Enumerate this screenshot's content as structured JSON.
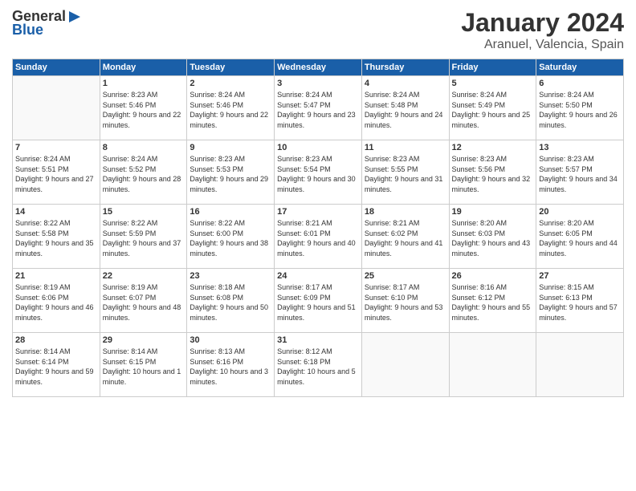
{
  "header": {
    "logo": {
      "general": "General",
      "blue": "Blue",
      "arrowIcon": "▶"
    },
    "title": "January 2024",
    "location": "Aranuel, Valencia, Spain"
  },
  "weekdays": [
    "Sunday",
    "Monday",
    "Tuesday",
    "Wednesday",
    "Thursday",
    "Friday",
    "Saturday"
  ],
  "weeks": [
    [
      {
        "day": "",
        "sunrise": "",
        "sunset": "",
        "daylight": ""
      },
      {
        "day": "1",
        "sunrise": "Sunrise: 8:23 AM",
        "sunset": "Sunset: 5:46 PM",
        "daylight": "Daylight: 9 hours and 22 minutes."
      },
      {
        "day": "2",
        "sunrise": "Sunrise: 8:24 AM",
        "sunset": "Sunset: 5:46 PM",
        "daylight": "Daylight: 9 hours and 22 minutes."
      },
      {
        "day": "3",
        "sunrise": "Sunrise: 8:24 AM",
        "sunset": "Sunset: 5:47 PM",
        "daylight": "Daylight: 9 hours and 23 minutes."
      },
      {
        "day": "4",
        "sunrise": "Sunrise: 8:24 AM",
        "sunset": "Sunset: 5:48 PM",
        "daylight": "Daylight: 9 hours and 24 minutes."
      },
      {
        "day": "5",
        "sunrise": "Sunrise: 8:24 AM",
        "sunset": "Sunset: 5:49 PM",
        "daylight": "Daylight: 9 hours and 25 minutes."
      },
      {
        "day": "6",
        "sunrise": "Sunrise: 8:24 AM",
        "sunset": "Sunset: 5:50 PM",
        "daylight": "Daylight: 9 hours and 26 minutes."
      }
    ],
    [
      {
        "day": "7",
        "sunrise": "Sunrise: 8:24 AM",
        "sunset": "Sunset: 5:51 PM",
        "daylight": "Daylight: 9 hours and 27 minutes."
      },
      {
        "day": "8",
        "sunrise": "Sunrise: 8:24 AM",
        "sunset": "Sunset: 5:52 PM",
        "daylight": "Daylight: 9 hours and 28 minutes."
      },
      {
        "day": "9",
        "sunrise": "Sunrise: 8:23 AM",
        "sunset": "Sunset: 5:53 PM",
        "daylight": "Daylight: 9 hours and 29 minutes."
      },
      {
        "day": "10",
        "sunrise": "Sunrise: 8:23 AM",
        "sunset": "Sunset: 5:54 PM",
        "daylight": "Daylight: 9 hours and 30 minutes."
      },
      {
        "day": "11",
        "sunrise": "Sunrise: 8:23 AM",
        "sunset": "Sunset: 5:55 PM",
        "daylight": "Daylight: 9 hours and 31 minutes."
      },
      {
        "day": "12",
        "sunrise": "Sunrise: 8:23 AM",
        "sunset": "Sunset: 5:56 PM",
        "daylight": "Daylight: 9 hours and 32 minutes."
      },
      {
        "day": "13",
        "sunrise": "Sunrise: 8:23 AM",
        "sunset": "Sunset: 5:57 PM",
        "daylight": "Daylight: 9 hours and 34 minutes."
      }
    ],
    [
      {
        "day": "14",
        "sunrise": "Sunrise: 8:22 AM",
        "sunset": "Sunset: 5:58 PM",
        "daylight": "Daylight: 9 hours and 35 minutes."
      },
      {
        "day": "15",
        "sunrise": "Sunrise: 8:22 AM",
        "sunset": "Sunset: 5:59 PM",
        "daylight": "Daylight: 9 hours and 37 minutes."
      },
      {
        "day": "16",
        "sunrise": "Sunrise: 8:22 AM",
        "sunset": "Sunset: 6:00 PM",
        "daylight": "Daylight: 9 hours and 38 minutes."
      },
      {
        "day": "17",
        "sunrise": "Sunrise: 8:21 AM",
        "sunset": "Sunset: 6:01 PM",
        "daylight": "Daylight: 9 hours and 40 minutes."
      },
      {
        "day": "18",
        "sunrise": "Sunrise: 8:21 AM",
        "sunset": "Sunset: 6:02 PM",
        "daylight": "Daylight: 9 hours and 41 minutes."
      },
      {
        "day": "19",
        "sunrise": "Sunrise: 8:20 AM",
        "sunset": "Sunset: 6:03 PM",
        "daylight": "Daylight: 9 hours and 43 minutes."
      },
      {
        "day": "20",
        "sunrise": "Sunrise: 8:20 AM",
        "sunset": "Sunset: 6:05 PM",
        "daylight": "Daylight: 9 hours and 44 minutes."
      }
    ],
    [
      {
        "day": "21",
        "sunrise": "Sunrise: 8:19 AM",
        "sunset": "Sunset: 6:06 PM",
        "daylight": "Daylight: 9 hours and 46 minutes."
      },
      {
        "day": "22",
        "sunrise": "Sunrise: 8:19 AM",
        "sunset": "Sunset: 6:07 PM",
        "daylight": "Daylight: 9 hours and 48 minutes."
      },
      {
        "day": "23",
        "sunrise": "Sunrise: 8:18 AM",
        "sunset": "Sunset: 6:08 PM",
        "daylight": "Daylight: 9 hours and 50 minutes."
      },
      {
        "day": "24",
        "sunrise": "Sunrise: 8:17 AM",
        "sunset": "Sunset: 6:09 PM",
        "daylight": "Daylight: 9 hours and 51 minutes."
      },
      {
        "day": "25",
        "sunrise": "Sunrise: 8:17 AM",
        "sunset": "Sunset: 6:10 PM",
        "daylight": "Daylight: 9 hours and 53 minutes."
      },
      {
        "day": "26",
        "sunrise": "Sunrise: 8:16 AM",
        "sunset": "Sunset: 6:12 PM",
        "daylight": "Daylight: 9 hours and 55 minutes."
      },
      {
        "day": "27",
        "sunrise": "Sunrise: 8:15 AM",
        "sunset": "Sunset: 6:13 PM",
        "daylight": "Daylight: 9 hours and 57 minutes."
      }
    ],
    [
      {
        "day": "28",
        "sunrise": "Sunrise: 8:14 AM",
        "sunset": "Sunset: 6:14 PM",
        "daylight": "Daylight: 9 hours and 59 minutes."
      },
      {
        "day": "29",
        "sunrise": "Sunrise: 8:14 AM",
        "sunset": "Sunset: 6:15 PM",
        "daylight": "Daylight: 10 hours and 1 minute."
      },
      {
        "day": "30",
        "sunrise": "Sunrise: 8:13 AM",
        "sunset": "Sunset: 6:16 PM",
        "daylight": "Daylight: 10 hours and 3 minutes."
      },
      {
        "day": "31",
        "sunrise": "Sunrise: 8:12 AM",
        "sunset": "Sunset: 6:18 PM",
        "daylight": "Daylight: 10 hours and 5 minutes."
      },
      {
        "day": "",
        "sunrise": "",
        "sunset": "",
        "daylight": ""
      },
      {
        "day": "",
        "sunrise": "",
        "sunset": "",
        "daylight": ""
      },
      {
        "day": "",
        "sunrise": "",
        "sunset": "",
        "daylight": ""
      }
    ]
  ]
}
